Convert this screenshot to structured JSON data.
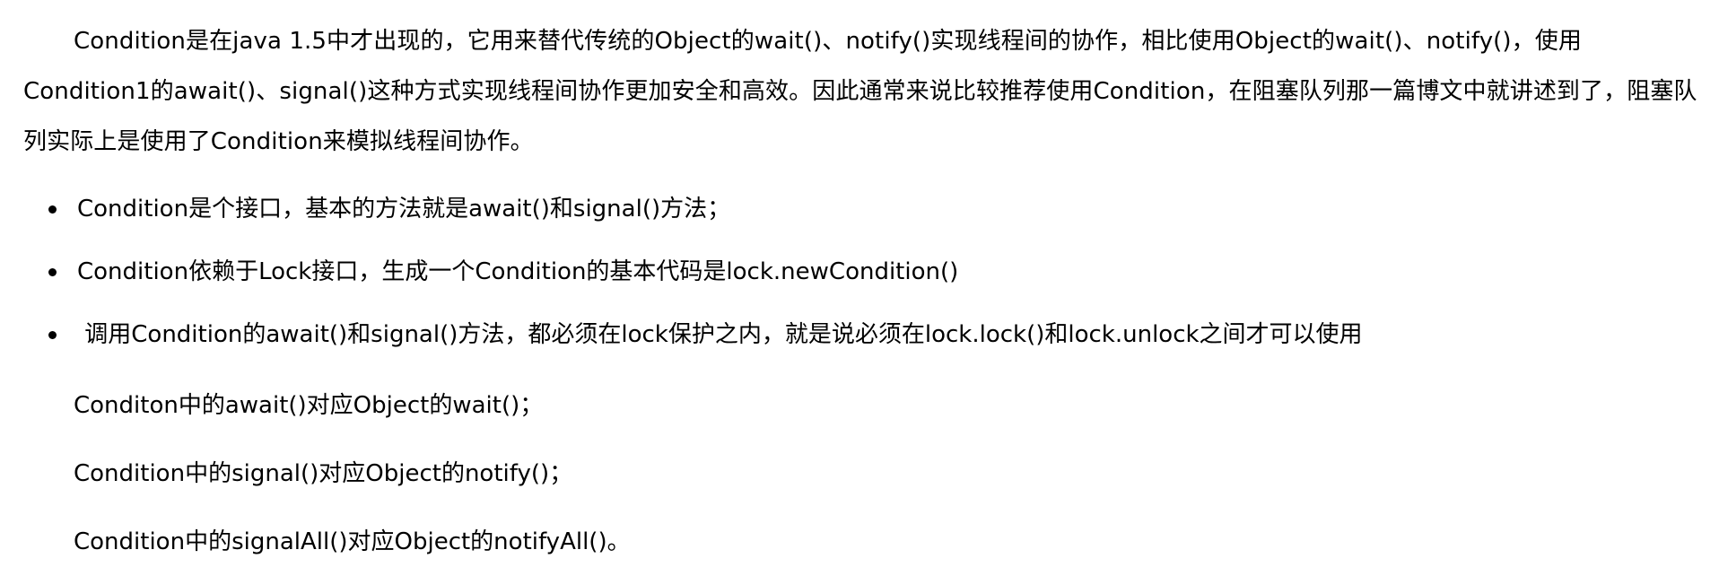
{
  "article": {
    "intro": "Condition是在java 1.5中才出现的，它用来替代传统的Object的wait()、notify()实现线程间的协作，相比使用Object的wait()、notify()，使用Condition1的await()、signal()这种方式实现线程间协作更加安全和高效。因此通常来说比较推荐使用Condition，在阻塞队列那一篇博文中就讲述到了，阻塞队列实际上是使用了Condition来模拟线程间协作。",
    "points": [
      "Condition是个接口，基本的方法就是await()和signal()方法；",
      "Condition依赖于Lock接口，生成一个Condition的基本代码是lock.newCondition()",
      " 调用Condition的await()和signal()方法，都必须在lock保护之内，就是说必须在lock.lock()和lock.unlock之间才可以使用"
    ],
    "mappings": [
      "Conditon中的await()对应Object的wait()；",
      "Condition中的signal()对应Object的notify()；",
      "Condition中的signalAll()对应Object的notifyAll()。"
    ]
  }
}
